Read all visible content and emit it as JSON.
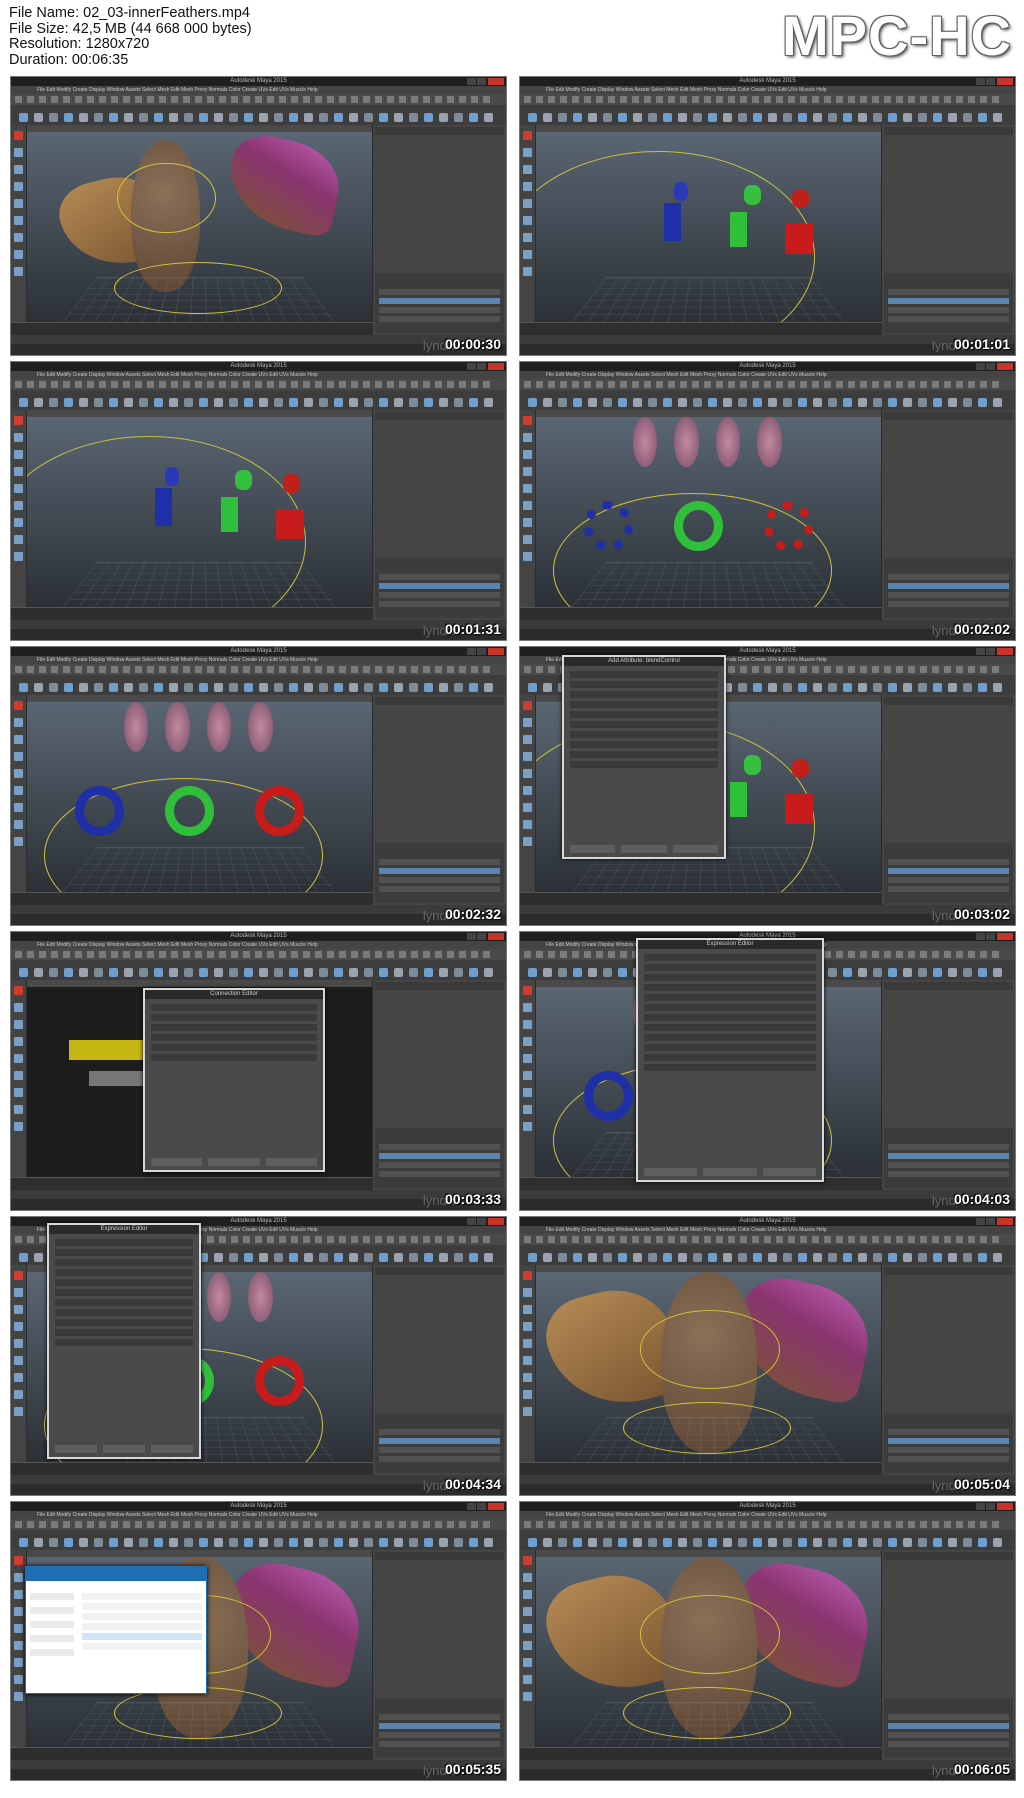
{
  "info": {
    "file_name": "File Name: 02_03-innerFeathers.mp4",
    "file_size": "File Size: 42,5 MB (44 668 000 bytes)",
    "resolution": "Resolution: 1280x720",
    "duration": "Duration: 00:06:35"
  },
  "player_logo": "MPC-HC",
  "app_title": "Autodesk Maya 2015",
  "menu_text": "File  Edit  Modify  Create  Display  Window  Assets  Select  Mesh  Edit Mesh  Proxy  Normals  Color  Create UVs  Edit UVs  Muscle  Help",
  "watermark": "lynda",
  "thumbnails": [
    {
      "timestamp": "00:00:30",
      "scene": "owl"
    },
    {
      "timestamp": "00:01:01",
      "scene": "prims"
    },
    {
      "timestamp": "00:01:31",
      "scene": "prims2"
    },
    {
      "timestamp": "00:02:02",
      "scene": "tori"
    },
    {
      "timestamp": "00:02:32",
      "scene": "tori2"
    },
    {
      "timestamp": "00:03:02",
      "scene": "attr"
    },
    {
      "timestamp": "00:03:33",
      "scene": "conn"
    },
    {
      "timestamp": "00:04:03",
      "scene": "expr"
    },
    {
      "timestamp": "00:04:34",
      "scene": "expr2"
    },
    {
      "timestamp": "00:05:04",
      "scene": "owl2"
    },
    {
      "timestamp": "00:05:35",
      "scene": "explorer"
    },
    {
      "timestamp": "00:06:05",
      "scene": "owl3"
    }
  ],
  "dialogs": {
    "add_attribute": "Add Attribute: blendControl",
    "connection_editor": "Connection Editor",
    "expression_editor": "Expression Editor"
  },
  "colors": {
    "maya_bg": "#3a3a3a",
    "selection_blue": "#5b84b0",
    "close_red": "#c8332a",
    "torus_blue": "#1f2fa8",
    "torus_green": "#2fbf3a",
    "torus_red": "#c81c1c"
  }
}
